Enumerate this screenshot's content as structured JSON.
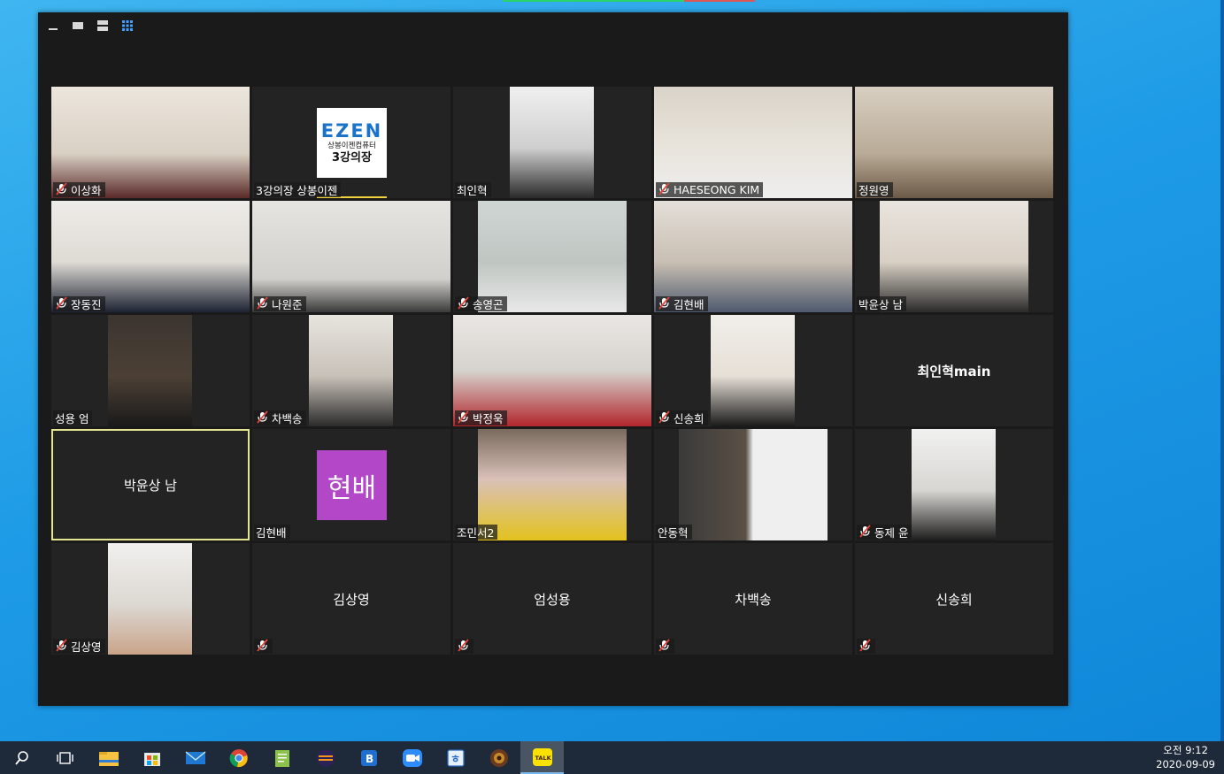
{
  "view_controls": [
    {
      "name": "minimize-view-button",
      "icon": "minimize-icon"
    },
    {
      "name": "speaker-view-button",
      "icon": "single-window-icon"
    },
    {
      "name": "side-by-side-view-button",
      "icon": "stacked-window-icon"
    },
    {
      "name": "gallery-view-button",
      "icon": "gallery-grid-icon"
    }
  ],
  "participants": [
    {
      "name": "이상화",
      "muted": true,
      "mode": "video"
    },
    {
      "name": "3강의장 상봉이젠",
      "muted": false,
      "mode": "logo",
      "logo": {
        "brand": "EZEN",
        "line1": "상봉이젠컴퓨터",
        "line2": "3강의장"
      }
    },
    {
      "name": "최인혁",
      "muted": false,
      "mode": "video"
    },
    {
      "name": "HAESEONG KIM",
      "muted": true,
      "mode": "video"
    },
    {
      "name": "정원영",
      "muted": false,
      "mode": "video"
    },
    {
      "name": "장동진",
      "muted": true,
      "mode": "video"
    },
    {
      "name": "나원준",
      "muted": true,
      "mode": "video"
    },
    {
      "name": "송영곤",
      "muted": true,
      "mode": "video"
    },
    {
      "name": "김현배",
      "muted": true,
      "mode": "video"
    },
    {
      "name": "박윤상 남",
      "muted": false,
      "mode": "video"
    },
    {
      "name": "성용 엄",
      "muted": false,
      "mode": "video"
    },
    {
      "name": "차백송",
      "muted": true,
      "mode": "video"
    },
    {
      "name": "박정욱",
      "muted": true,
      "mode": "video"
    },
    {
      "name": "신송희",
      "muted": true,
      "mode": "video"
    },
    {
      "name": "최인혁main",
      "muted": false,
      "mode": "name-only"
    },
    {
      "name": "박윤상 남",
      "muted": false,
      "mode": "name-only",
      "active": true
    },
    {
      "name": "김현배",
      "muted": false,
      "mode": "avatar",
      "avatar_text": "현배"
    },
    {
      "name": "조민서2",
      "muted": false,
      "mode": "video"
    },
    {
      "name": "안동혁",
      "muted": false,
      "mode": "video"
    },
    {
      "name": "동제 윤",
      "muted": true,
      "mode": "video"
    },
    {
      "name": "김상영",
      "muted": true,
      "mode": "video"
    },
    {
      "name": "김상영",
      "muted": true,
      "mode": "name-only"
    },
    {
      "name": "엄성용",
      "muted": true,
      "mode": "name-only"
    },
    {
      "name": "차백송",
      "muted": true,
      "mode": "name-only"
    },
    {
      "name": "신송희",
      "muted": true,
      "mode": "name-only"
    }
  ],
  "taskbar": {
    "icons": [
      "search-icon",
      "task-view-icon",
      "file-explorer-icon",
      "microsoft-store-icon",
      "mail-icon",
      "chrome-icon",
      "notepad-plus-icon",
      "eclipse-icon",
      "bandizip-icon",
      "zoom-icon",
      "hangul-icon",
      "game-icon",
      "kakaotalk-icon"
    ],
    "kakao_label": "TALK"
  },
  "clock": {
    "time": "오전 9:12",
    "date": "2020-09-09"
  },
  "colors": {
    "accent": "#f0d23c",
    "avatar": "#b247c7",
    "mute": "#e0443c",
    "window": "#1a1a1a"
  }
}
